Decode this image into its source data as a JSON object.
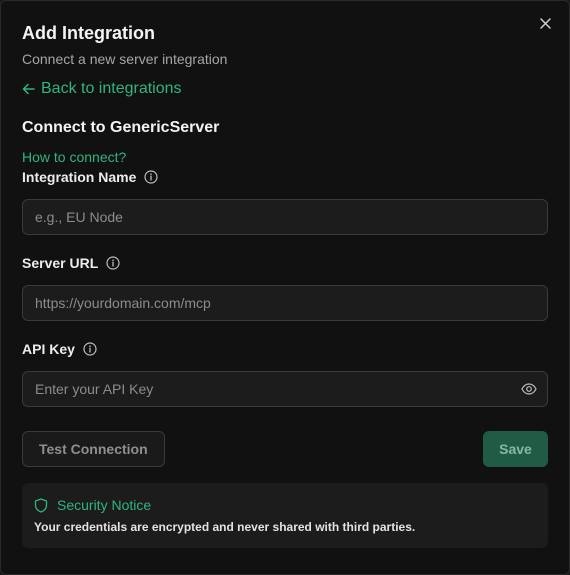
{
  "dialog": {
    "title": "Add Integration",
    "subtitle": "Connect a new server integration",
    "back_label": "Back to integrations",
    "section_title": "Connect to GenericServer",
    "how_to_label": "How to connect?"
  },
  "fields": {
    "name": {
      "label": "Integration Name",
      "value": "",
      "placeholder": "e.g., EU Node"
    },
    "url": {
      "label": "Server URL",
      "value": "",
      "placeholder": "https://yourdomain.com/mcp"
    },
    "api_key": {
      "label": "API Key",
      "value": "",
      "placeholder": "Enter your API Key"
    }
  },
  "buttons": {
    "test_label": "Test Connection",
    "save_label": "Save"
  },
  "notice": {
    "title": "Security Notice",
    "text": "Your credentials are encrypted and never shared with third parties."
  },
  "colors": {
    "accent": "#2fb57e",
    "save_bg": "#1f5b45",
    "background": "#111111"
  },
  "icons": {
    "close": "close-icon",
    "back": "arrow-left-icon",
    "info": "info-icon",
    "eye": "eye-icon",
    "shield": "shield-icon"
  }
}
